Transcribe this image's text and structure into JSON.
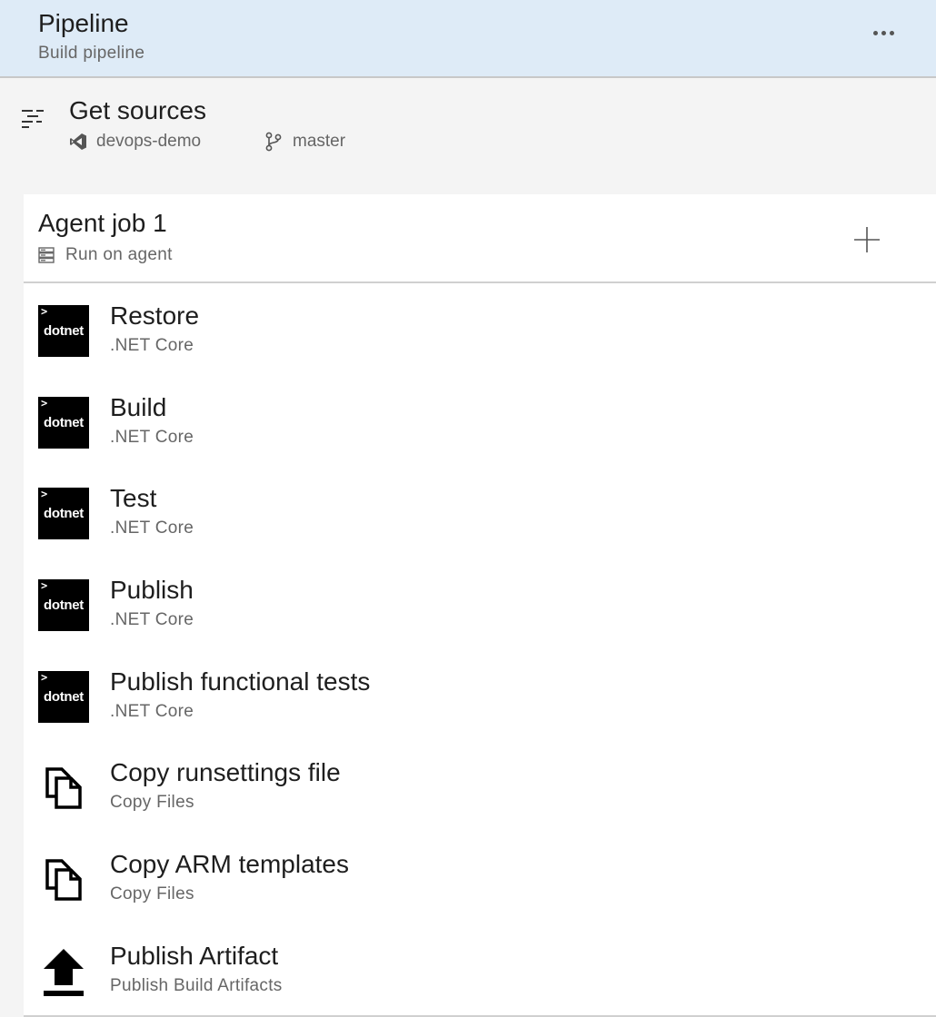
{
  "pipeline": {
    "title": "Pipeline",
    "subtitle": "Build pipeline"
  },
  "get_sources": {
    "title": "Get sources",
    "repository": "devops-demo",
    "branch": "master"
  },
  "agent_job": {
    "title": "Agent job 1",
    "subtitle": "Run on agent"
  },
  "tasks": [
    {
      "name": "Restore",
      "type": ".NET Core",
      "icon": "dotnet-icon",
      "icon_text": "dotnet",
      "icon_prompt": ">"
    },
    {
      "name": "Build",
      "type": ".NET Core",
      "icon": "dotnet-icon",
      "icon_text": "dotnet",
      "icon_prompt": ">"
    },
    {
      "name": "Test",
      "type": ".NET Core",
      "icon": "dotnet-icon",
      "icon_text": "dotnet",
      "icon_prompt": ">"
    },
    {
      "name": "Publish",
      "type": ".NET Core",
      "icon": "dotnet-icon",
      "icon_text": "dotnet",
      "icon_prompt": ">"
    },
    {
      "name": "Publish functional tests",
      "type": ".NET Core",
      "icon": "dotnet-icon",
      "icon_text": "dotnet",
      "icon_prompt": ">"
    },
    {
      "name": "Copy runsettings file",
      "type": "Copy Files",
      "icon": "copy-files-icon"
    },
    {
      "name": "Copy ARM templates",
      "type": "Copy Files",
      "icon": "copy-files-icon"
    },
    {
      "name": "Publish Artifact",
      "type": "Publish Build Artifacts",
      "icon": "upload-icon"
    }
  ],
  "colors": {
    "header_background": "#deebf7",
    "page_background": "#f4f4f4",
    "panel_background": "#ffffff",
    "secondary_text": "#666666"
  }
}
